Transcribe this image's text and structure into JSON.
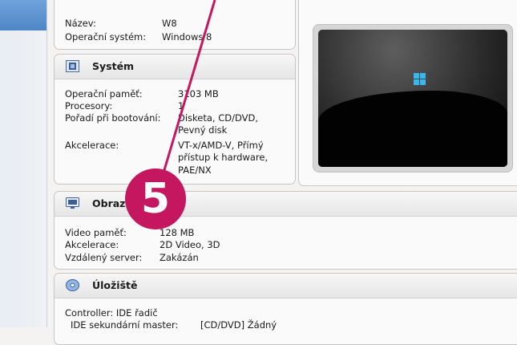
{
  "general": {
    "rows": [
      {
        "label": "Název:",
        "value": "W8"
      },
      {
        "label": "Operační systém:",
        "value": "Windows 8"
      }
    ]
  },
  "system": {
    "title": "Systém",
    "rows": [
      {
        "label": "Operační paměť:",
        "value": "3103 MB"
      },
      {
        "label": "Procesory:",
        "value": "1"
      },
      {
        "label": "Pořadí při bootování:",
        "value": "Disketa, CD/DVD,"
      },
      {
        "label": "",
        "value": "Pevný disk"
      },
      {
        "label": "Akcelerace:",
        "value": "VT-x/AMD-V, Přímý"
      },
      {
        "label": "",
        "value": "přístup k hardware,"
      },
      {
        "label": "",
        "value": "PAE/NX"
      }
    ]
  },
  "display": {
    "title": "Obraz",
    "rows": [
      {
        "label": "Video paměť:",
        "value": "128 MB"
      },
      {
        "label": "Akcelerace:",
        "value": "2D Video, 3D"
      },
      {
        "label": "Vzdálený server:",
        "value": "Zakázán"
      }
    ]
  },
  "storage": {
    "title": "Úložiště",
    "rows": [
      {
        "label": "Controller: IDE řadič",
        "value": ""
      },
      {
        "label": "IDE sekundární master:",
        "value": "[CD/DVD] Žádný"
      }
    ]
  },
  "callout": {
    "number": "5",
    "color": "#c4175f"
  },
  "icons": {
    "system": "chip-icon",
    "display": "monitor-icon",
    "storage": "disc-icon",
    "preview_logo": "windows-logo-icon"
  }
}
